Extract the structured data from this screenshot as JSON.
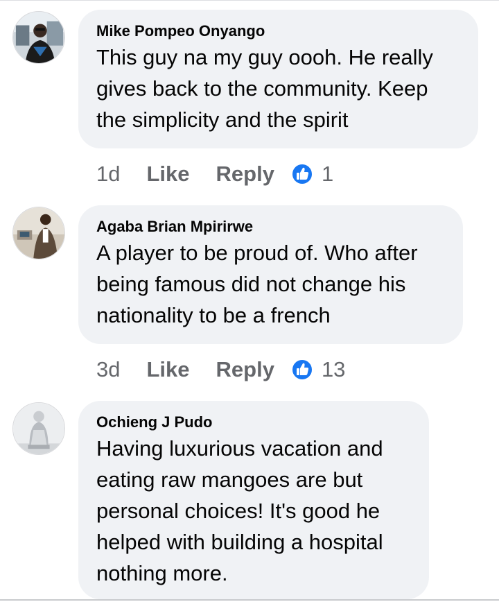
{
  "colors": {
    "bubble_bg": "#f0f2f5",
    "text": "#050505",
    "meta_text": "#65676b",
    "like_blue": "#1877f2"
  },
  "comments": [
    {
      "author": "Mike Pompeo Onyango",
      "text": "This guy na my guy oooh. He really gives back to the community. Keep the simplicity and the spirit",
      "time": "1d",
      "like_label": "Like",
      "reply_label": "Reply",
      "reaction_icon": "thumbs-up-icon",
      "reaction_count": "1"
    },
    {
      "author": "Agaba Brian Mpirirwe",
      "text": "A player to be proud of. Who after being famous did not change his nationality to be a french",
      "time": "3d",
      "like_label": "Like",
      "reply_label": "Reply",
      "reaction_icon": "thumbs-up-icon",
      "reaction_count": "13"
    },
    {
      "author": "Ochieng J Pudo",
      "text": "Having luxurious vacation and eating raw mangoes are but personal choices! It's good he helped with building a hospital nothing more."
    }
  ]
}
